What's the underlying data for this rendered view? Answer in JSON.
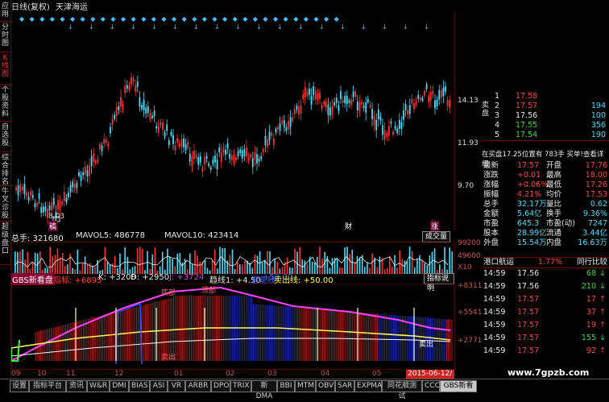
{
  "title": {
    "mode": "日线(复权)",
    "name": "天津海运"
  },
  "sidebar": [
    {
      "label": "应用",
      "active": false
    },
    {
      "label": "分时图",
      "active": false
    },
    {
      "label": "K线图",
      "active": true
    },
    {
      "label": "个股资料",
      "active": false
    },
    {
      "label": "自选股",
      "active": false
    },
    {
      "label": "综合排名",
      "active": false
    },
    {
      "label": "牛叉诊股",
      "active": false
    },
    {
      "label": "超级盘口",
      "active": false
    }
  ],
  "price_axis": {
    "high": "14.13",
    "mid": "11.93",
    "low": "9.70"
  },
  "low_marker": "8.03",
  "chart_markers": [
    "稿",
    "财",
    "涨"
  ],
  "volume": {
    "label": "总手: 321680",
    "ma5": "MAVOL5: 486778",
    "ma10": "MAVOL10: 423414",
    "button": "成交量",
    "axis_top": "99200",
    "axis_mid": "49600",
    "axis_unit": "X10"
  },
  "indicator": {
    "name": "GBS新看盘",
    "zb": "指标: +6895",
    "k": "K: +3208",
    "d": "D: +2950",
    "j": "J: +3724",
    "qx": "趋线1: +4.50",
    "r1": "智能线",
    "r2": "+50.00",
    "r3": "卖出线: +50.00",
    "button": "指标说明",
    "axis": [
      "+8311",
      "+5541",
      "+2771"
    ],
    "labels": [
      "底部",
      "顶部",
      "卖出",
      "卖出"
    ]
  },
  "dates": [
    "09",
    "10",
    "11",
    "12",
    "01",
    "02",
    "03",
    "04",
    "05"
  ],
  "date_highlight": "2015-06-12/五",
  "tabs": [
    "设置",
    "指标平台",
    "资讯",
    "W&R",
    "DMI",
    "BIAS",
    "ASI",
    "VR",
    "ARBR",
    "DPO",
    "TRIX",
    "新DMA",
    "BBI",
    "MTM",
    "OBV",
    "SAR",
    "EXPMA",
    "同花顺测试",
    "CCC",
    "GBS新看盘"
  ],
  "right_panel": {
    "sell_label": "卖盘",
    "buy_label": "买盘",
    "orders": [
      {
        "n": "1",
        "price": "17.58",
        "vol": ""
      },
      {
        "n": "2",
        "price": "17.57",
        "vol": "194"
      },
      {
        "n": "3",
        "price": "17.56",
        "vol": "100"
      },
      {
        "n": "4",
        "price": "17.55",
        "vol": "356"
      },
      {
        "n": "5",
        "price": "17.54",
        "vol": "190"
      }
    ],
    "notice": "在买盘17.25位置有 783手 买单!查看详细",
    "stats": [
      [
        "最新",
        "17.57",
        "开盘",
        "17.76"
      ],
      [
        "涨跌",
        "+0.01",
        "最高",
        "18.00"
      ],
      [
        "涨幅",
        "+0.06%",
        "最低",
        "17.26"
      ],
      [
        "振幅",
        "4.21%",
        "均价",
        "17.53"
      ],
      [
        "总手",
        "32.17万",
        "量比",
        "0.62"
      ],
      [
        "金额",
        "5.64亿",
        "换手",
        "9.36%"
      ],
      [
        "市盈",
        "645.3",
        "市盈(动)",
        "7247"
      ],
      [
        "股本",
        "28.99亿",
        "流通",
        "3.44亿"
      ],
      [
        "外盘",
        "15.54万",
        "内盘",
        "16.63万"
      ]
    ],
    "sector": {
      "name": "港口航运",
      "pct": "1.77%",
      "link": "同行比较"
    },
    "ticks": [
      {
        "t": "14:59",
        "p": "17.56",
        "v": "68",
        "d": "down"
      },
      {
        "t": "14:59",
        "p": "17.56",
        "v": "210",
        "d": "down"
      },
      {
        "t": "14:59",
        "p": "17.57",
        "v": "17",
        "d": "up"
      },
      {
        "t": "14:59",
        "p": "17.57",
        "v": "37",
        "d": "up"
      },
      {
        "t": "14:59",
        "p": "17.57",
        "v": "19",
        "d": "up"
      },
      {
        "t": "14:59",
        "p": "17.57",
        "v": "155",
        "d": "down"
      },
      {
        "t": "14:59",
        "p": "17.57",
        "v": "92",
        "d": "up"
      }
    ]
  },
  "watermark": "www.7gpzb.com",
  "colors": {
    "up": "#ff3030",
    "down": "#40e0ff",
    "ma": "#ffffff",
    "bg": "#000000"
  }
}
